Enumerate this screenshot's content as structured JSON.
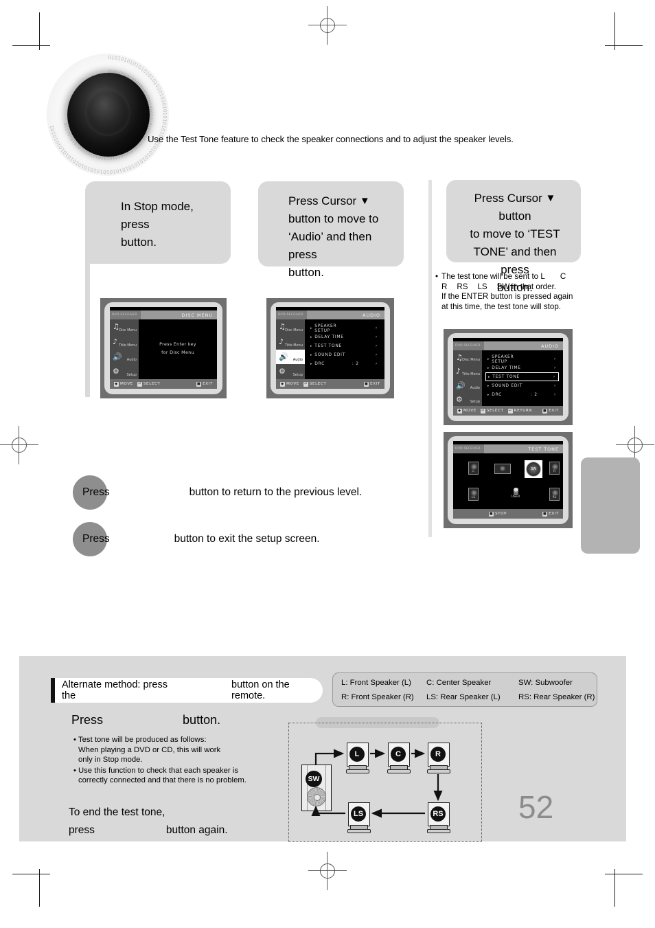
{
  "intro": "Use the Test Tone feature to check the speaker connections and to adjust the speaker levels.",
  "steps": [
    {
      "id": "step-1",
      "line1": "In Stop mode,",
      "line2": "press",
      "line3": "button."
    },
    {
      "id": "step-2",
      "line1a": "Press Cursor",
      "line1b": "▼",
      "line2": "button to move to",
      "line3": "‘Audio’ and then",
      "line4a": "press",
      "line4b": "button."
    },
    {
      "id": "step-3",
      "line1a": "Press Cursor",
      "line1b": "▼",
      "line1c": "button",
      "line2": "to move to ‘TEST",
      "line3": "TONE’ and then press",
      "line4": "button."
    }
  ],
  "note3": {
    "bullet": "•",
    "line1a": "The test tone will be sent to L",
    "line1b": "C",
    "line2a": "R",
    "line2b": "RS",
    "line2c": "LS",
    "line2d": "SW in that order.",
    "line3": "If the ENTER button is pressed again",
    "line4": "at this time, the test tone will stop."
  },
  "osd": {
    "sidebar": [
      {
        "label": "Disc Menu",
        "icon": "disc-menu-icon"
      },
      {
        "label": "Title Menu",
        "icon": "title-menu-icon"
      },
      {
        "label": "Audio",
        "icon": "speaker-icon"
      },
      {
        "label": "Setup",
        "icon": "gear-icon"
      }
    ],
    "screen1": {
      "header_left": "DVD RECEIVER",
      "header_right": "DISC MENU",
      "message_line1": "Press Enter key",
      "message_line2": "for Disc Menu",
      "footer": [
        {
          "key": "◆",
          "label": "MOVE"
        },
        {
          "key": "⏎",
          "label": "SELECT"
        },
        {
          "key": "■",
          "label": "EXIT"
        }
      ]
    },
    "screen2": {
      "header_left": "DVD RECEIVER",
      "header_right": "AUDIO",
      "selected_sidebar": "Audio",
      "rows": [
        {
          "name": "SPEAKER SETUP",
          "value": "",
          "arrow": "›",
          "highlight": false
        },
        {
          "name": "DELAY TIME",
          "value": "",
          "arrow": "›",
          "highlight": false
        },
        {
          "name": "TEST TONE",
          "value": "",
          "arrow": "›",
          "highlight": false
        },
        {
          "name": "SOUND EDIT",
          "value": "",
          "arrow": "›",
          "highlight": false
        },
        {
          "name": "DRC",
          "value": ": 2",
          "arrow": "›",
          "highlight": false
        }
      ],
      "footer": [
        {
          "key": "◆",
          "label": "MOVE"
        },
        {
          "key": "⏎",
          "label": "SELECT"
        },
        {
          "key": "■",
          "label": "EXIT"
        }
      ]
    },
    "screen3": {
      "header_left": "DVD RECEIVER",
      "header_right": "AUDIO",
      "selected_sidebar": "Audio",
      "rows": [
        {
          "name": "SPEAKER SETUP",
          "value": "",
          "arrow": "›",
          "highlight": false
        },
        {
          "name": "DELAY TIME",
          "value": "",
          "arrow": "›",
          "highlight": false
        },
        {
          "name": "TEST TONE",
          "value": "",
          "arrow": "›",
          "highlight": true
        },
        {
          "name": "SOUND EDIT",
          "value": "",
          "arrow": "›",
          "highlight": false
        },
        {
          "name": "DRC",
          "value": ": 2",
          "arrow": "›",
          "highlight": false
        }
      ],
      "footer": [
        {
          "key": "◆",
          "label": "MOVE"
        },
        {
          "key": "⏎",
          "label": "SELECT"
        },
        {
          "key": "↩",
          "label": "RETURN"
        },
        {
          "key": "■",
          "label": "EXIT"
        }
      ]
    },
    "screen4": {
      "header_left": "DVD RECEIVER",
      "header_right": "TEST TONE",
      "speakers": [
        {
          "id": "L",
          "selected": false
        },
        {
          "id": "C",
          "selected": false
        },
        {
          "id": "SW",
          "selected": true
        },
        {
          "id": "R",
          "selected": false
        },
        {
          "id": "LS",
          "selected": false
        },
        {
          "id": "RS",
          "selected": false
        }
      ],
      "center_label": "USER",
      "footer": [
        {
          "key": "■",
          "label": "STOP"
        },
        {
          "key": "■",
          "label": "EXIT"
        }
      ]
    }
  },
  "mid_lines": [
    {
      "press": "Press",
      "rest": "button to return to the previous level."
    },
    {
      "press": "Press",
      "rest": "button to exit the setup screen."
    }
  ],
  "bottom": {
    "alt_method_prefix": "Alternate method: press the",
    "alt_method_suffix": "button on the remote.",
    "press_label": "Press",
    "press_button_word": "button.",
    "bullets": [
      [
        "Test tone will be produced as follows:",
        "When playing a DVD or CD, this will work",
        "only in Stop mode."
      ],
      [
        "Use this function to check that each speaker is",
        "correctly connected and that there is no problem."
      ]
    ],
    "end_line1": "To end the test tone,",
    "end_line2a": "press",
    "end_line2b": "button again."
  },
  "legend": [
    {
      "c1": "L: Front Speaker (L)",
      "c2": "C: Center Speaker",
      "c3": "SW: Subwoofer"
    },
    {
      "c1": "R: Front Speaker (R)",
      "c2": "LS: Rear Speaker (L)",
      "c3": "RS: Rear Speaker (R)"
    }
  ],
  "diagram": {
    "type": "flow",
    "nodes": [
      "SW",
      "L",
      "C",
      "R",
      "RS",
      "LS"
    ],
    "order": [
      "SW",
      "L",
      "C",
      "R",
      "RS",
      "LS",
      "SW"
    ]
  },
  "page_number": "52"
}
